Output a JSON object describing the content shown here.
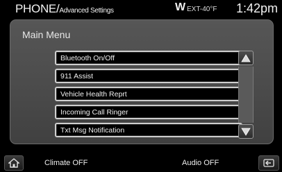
{
  "header": {
    "title": "PHONE/",
    "subtitle": "Advanced Settings",
    "compass": "W",
    "ext_temp": "EXT-40°F",
    "time": "1:42pm"
  },
  "panel": {
    "title": "Main Menu",
    "items": [
      {
        "label": "Bluetooth On/Off"
      },
      {
        "label": "911 Assist"
      },
      {
        "label": "Vehicle Health Reprt"
      },
      {
        "label": "Incoming Call Ringer"
      },
      {
        "label": "Txt Msg Notification"
      }
    ]
  },
  "footer": {
    "climate": "Climate OFF",
    "audio": "Audio OFF"
  },
  "icons": {
    "home": "home-icon",
    "back": "back-icon",
    "scroll_up": "arrow-up-icon",
    "scroll_down": "arrow-down-icon"
  },
  "colors": {
    "panel_bg": "#4e4e4e",
    "item_border": "#cfcfcf",
    "item_bg": "#000000"
  }
}
